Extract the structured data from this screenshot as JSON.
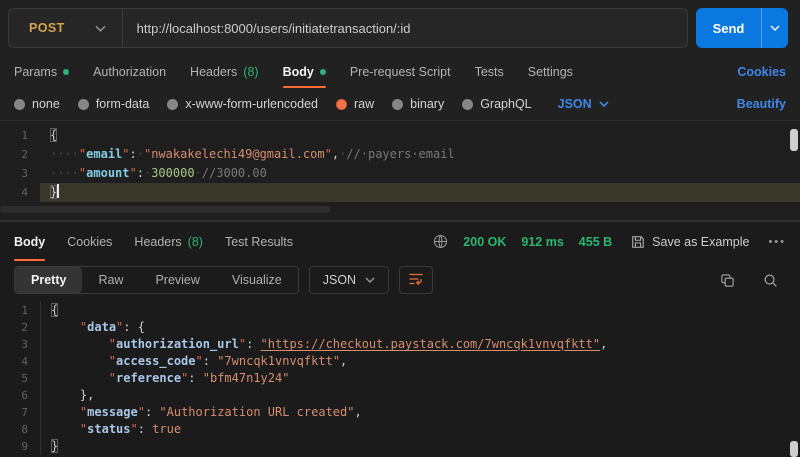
{
  "colors": {
    "accent_orange": "#ff6c37",
    "method_post": "#d7a44a",
    "send_blue": "#0b78e0",
    "link_blue": "#3f88e8",
    "success_green": "#2bb673"
  },
  "request_bar": {
    "method": "POST",
    "url": "http://localhost:8000/users/initiatetransaction/:id",
    "send_label": "Send"
  },
  "request_tabs": {
    "items": [
      {
        "label": "Params",
        "dot": true
      },
      {
        "label": "Authorization"
      },
      {
        "label": "Headers",
        "count": "(8)"
      },
      {
        "label": "Body",
        "dot": true,
        "active": true
      },
      {
        "label": "Pre-request Script"
      },
      {
        "label": "Tests"
      },
      {
        "label": "Settings"
      }
    ],
    "cookies_link": "Cookies"
  },
  "body_type_bar": {
    "options": [
      {
        "label": "none",
        "selected": false
      },
      {
        "label": "form-data",
        "selected": false
      },
      {
        "label": "x-www-form-urlencoded",
        "selected": false
      },
      {
        "label": "raw",
        "selected": true
      },
      {
        "label": "binary",
        "selected": false
      },
      {
        "label": "GraphQL",
        "selected": false
      }
    ],
    "language": "JSON",
    "beautify_link": "Beautify"
  },
  "request_editor": {
    "lines": [
      {
        "num": "1",
        "segments": [
          {
            "text": "{",
            "cls": "punct match"
          }
        ]
      },
      {
        "num": "2",
        "segments": [
          {
            "text": "····",
            "cls": "ws"
          },
          {
            "text": "\"",
            "cls": "q"
          },
          {
            "text": "email",
            "cls": "key"
          },
          {
            "text": "\"",
            "cls": "q"
          },
          {
            "text": ":",
            "cls": "punct"
          },
          {
            "text": "·",
            "cls": "ws"
          },
          {
            "text": "\"",
            "cls": "q"
          },
          {
            "text": "nwakakelechi49@gmail.com",
            "cls": "str"
          },
          {
            "text": "\"",
            "cls": "q"
          },
          {
            "text": ",",
            "cls": "punct"
          },
          {
            "text": "·",
            "cls": "ws"
          },
          {
            "text": "//·payers·email",
            "cls": "cmt"
          }
        ]
      },
      {
        "num": "3",
        "segments": [
          {
            "text": "····",
            "cls": "ws"
          },
          {
            "text": "\"",
            "cls": "q"
          },
          {
            "text": "amount",
            "cls": "key"
          },
          {
            "text": "\"",
            "cls": "q"
          },
          {
            "text": ":",
            "cls": "punct"
          },
          {
            "text": "·",
            "cls": "ws"
          },
          {
            "text": "300000",
            "cls": "num"
          },
          {
            "text": "·",
            "cls": "ws"
          },
          {
            "text": "//3000.00",
            "cls": "cmt"
          }
        ]
      },
      {
        "num": "4",
        "highlight": true,
        "cursor": true,
        "segments": [
          {
            "text": "}",
            "cls": "punct match"
          }
        ]
      }
    ]
  },
  "response_header": {
    "tabs": [
      {
        "label": "Body",
        "active": true
      },
      {
        "label": "Cookies"
      },
      {
        "label": "Headers",
        "count": "(8)"
      },
      {
        "label": "Test Results"
      }
    ],
    "status_code": "200 OK",
    "time": "912 ms",
    "size": "455 B",
    "save_label": "Save as Example",
    "more_label": "•••"
  },
  "response_toolbar": {
    "views": [
      {
        "label": "Pretty",
        "active": true
      },
      {
        "label": "Raw"
      },
      {
        "label": "Preview"
      },
      {
        "label": "Visualize"
      }
    ],
    "language": "JSON"
  },
  "response_viewer": {
    "lines": [
      {
        "num": "1",
        "segments": [
          {
            "text": "{",
            "cls": "punct match"
          }
        ]
      },
      {
        "num": "2",
        "segments": [
          {
            "text": "    ",
            "cls": "ind"
          },
          {
            "text": "\"",
            "cls": "q"
          },
          {
            "text": "data",
            "cls": "key2"
          },
          {
            "text": "\"",
            "cls": "q"
          },
          {
            "text": ": {",
            "cls": "punct"
          }
        ]
      },
      {
        "num": "3",
        "segments": [
          {
            "text": "        ",
            "cls": "ind"
          },
          {
            "text": "\"",
            "cls": "q"
          },
          {
            "text": "authorization_url",
            "cls": "key2"
          },
          {
            "text": "\"",
            "cls": "q"
          },
          {
            "text": ": ",
            "cls": "punct"
          },
          {
            "text": "\"https://checkout.paystack.com/7wncqk1vnvqfktt\"",
            "cls": "link"
          },
          {
            "text": ",",
            "cls": "punct"
          }
        ]
      },
      {
        "num": "4",
        "segments": [
          {
            "text": "        ",
            "cls": "ind"
          },
          {
            "text": "\"",
            "cls": "q"
          },
          {
            "text": "access_code",
            "cls": "key2"
          },
          {
            "text": "\"",
            "cls": "q"
          },
          {
            "text": ": ",
            "cls": "punct"
          },
          {
            "text": "\"7wncqk1vnvqfktt\"",
            "cls": "str"
          },
          {
            "text": ",",
            "cls": "punct"
          }
        ]
      },
      {
        "num": "5",
        "segments": [
          {
            "text": "        ",
            "cls": "ind"
          },
          {
            "text": "\"",
            "cls": "q"
          },
          {
            "text": "reference",
            "cls": "key2"
          },
          {
            "text": "\"",
            "cls": "q"
          },
          {
            "text": ": ",
            "cls": "punct"
          },
          {
            "text": "\"bfm47n1y24\"",
            "cls": "str"
          }
        ]
      },
      {
        "num": "6",
        "segments": [
          {
            "text": "    ",
            "cls": "ind"
          },
          {
            "text": "},",
            "cls": "punct"
          }
        ]
      },
      {
        "num": "7",
        "segments": [
          {
            "text": "    ",
            "cls": "ind"
          },
          {
            "text": "\"",
            "cls": "q"
          },
          {
            "text": "message",
            "cls": "key2"
          },
          {
            "text": "\"",
            "cls": "q"
          },
          {
            "text": ": ",
            "cls": "punct"
          },
          {
            "text": "\"Authorization URL created\"",
            "cls": "str"
          },
          {
            "text": ",",
            "cls": "punct"
          }
        ]
      },
      {
        "num": "8",
        "segments": [
          {
            "text": "    ",
            "cls": "ind"
          },
          {
            "text": "\"",
            "cls": "q"
          },
          {
            "text": "status",
            "cls": "key2"
          },
          {
            "text": "\"",
            "cls": "q"
          },
          {
            "text": ": ",
            "cls": "punct"
          },
          {
            "text": "true",
            "cls": "bool"
          }
        ]
      },
      {
        "num": "9",
        "segments": [
          {
            "text": "}",
            "cls": "punct match"
          }
        ]
      }
    ]
  }
}
